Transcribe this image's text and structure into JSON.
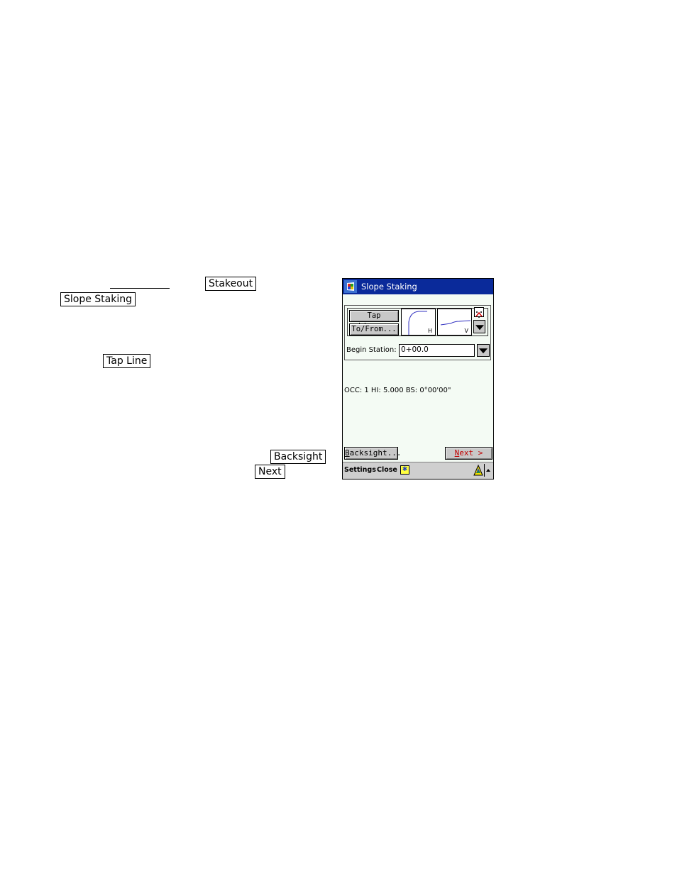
{
  "document": {
    "inline_buttons": {
      "stakeout": "Stakeout",
      "slope_staking": "Slope Staking",
      "tap_line": "Tap Line",
      "backsight": "Backsight",
      "next": "Next"
    }
  },
  "device": {
    "title": "Slope Staking",
    "buttons": {
      "tap_line": "Tap Line...",
      "to_from": "To/From...",
      "backsight_prefix": "B",
      "backsight_rest": "acksight...",
      "next_prefix": "N",
      "next_rest": "ext >"
    },
    "previews": {
      "horizontal_label": "H",
      "vertical_label": "V"
    },
    "begin_station": {
      "label": "Begin Station:",
      "value": "0+00.0"
    },
    "status_line": "OCC: 1  HI: 5.000  BS: 0°00'00\"",
    "command_bar": {
      "settings": "Settings",
      "close": "Close",
      "sip_icon": "keyboard-star-icon"
    },
    "colors": {
      "titlebar": "#0a2a9a",
      "background": "#f4fbf4",
      "next_text": "#c00000",
      "preview_line": "#3030c0"
    }
  }
}
